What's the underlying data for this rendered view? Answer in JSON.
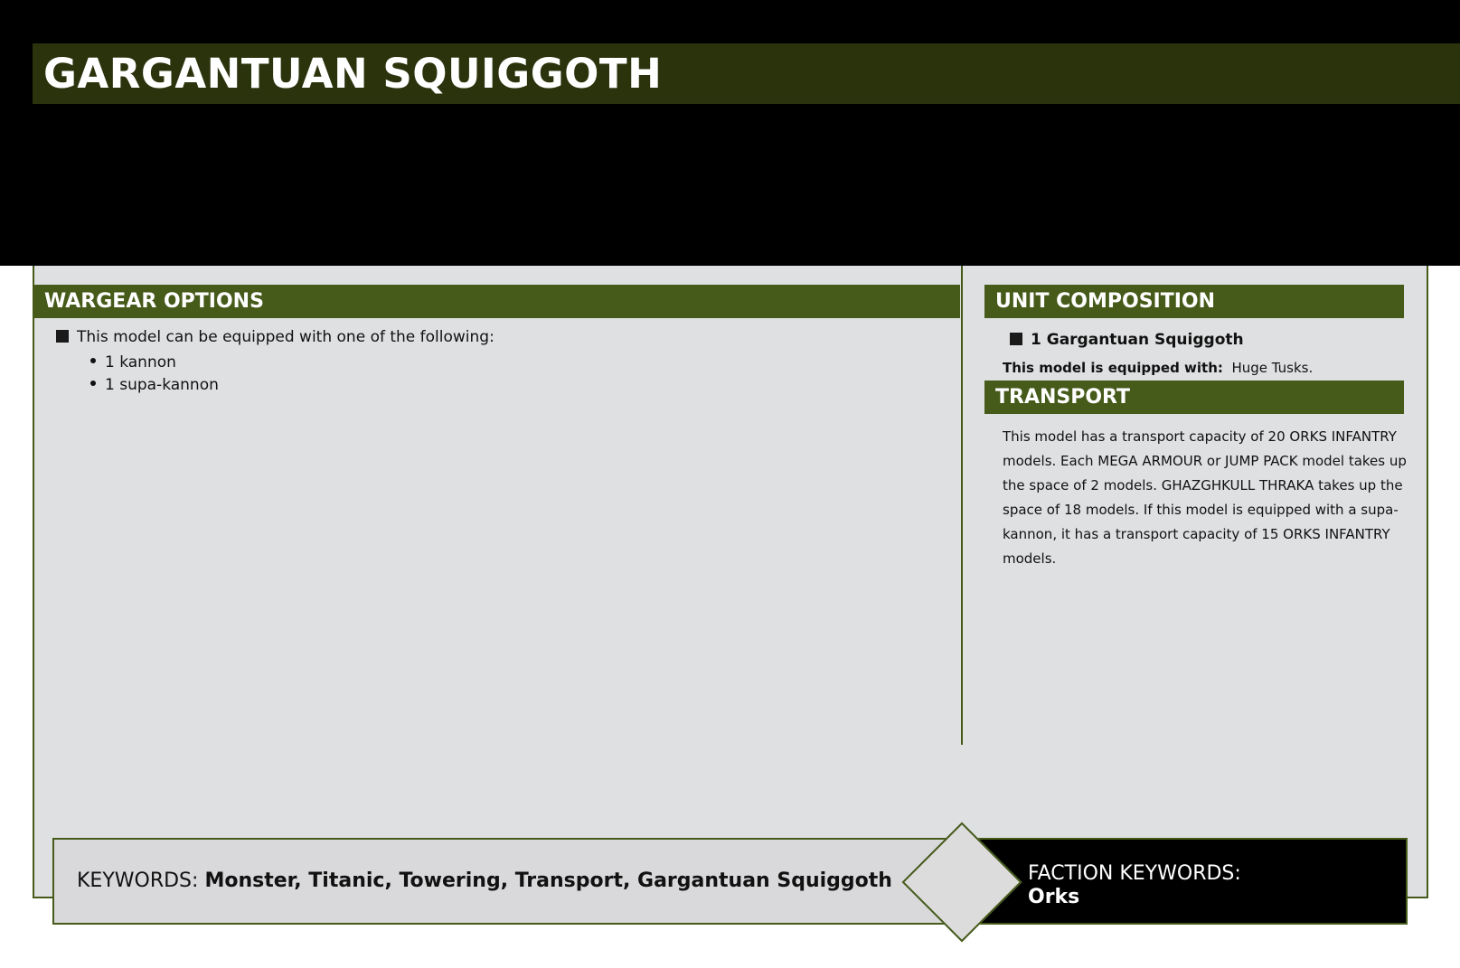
{
  "card": {
    "title": "GARGANTUAN SQUIGGOTH"
  },
  "wargear": {
    "header": "WARGEAR OPTIONS",
    "intro": "This model can be equipped with one of the following:",
    "options": [
      "1 kannon",
      "1 supa-kannon"
    ]
  },
  "unit_composition": {
    "header": "UNIT COMPOSITION",
    "item": "1 Gargantuan Squiggoth",
    "equipped_label": "This model is equipped with:",
    "equipped_value": "Huge Tusks."
  },
  "transport": {
    "header": "TRANSPORT",
    "text": "This model has a transport capacity of 20 ORKS INFANTRY models. Each MEGA ARMOUR or JUMP PACK model takes up the space of 2 models. GHAZGHKULL THRAKA takes up the space of 18 models. If this model is equipped with a supa-kannon, it has a transport capacity of 15 ORKS INFANTRY models."
  },
  "keywords": {
    "label": "KEYWORDS:",
    "values": "Monster, Titanic, Towering, Transport, Gargantuan Squiggoth"
  },
  "faction_keywords": {
    "label": "FACTION KEYWORDS:",
    "values": "Orks"
  },
  "colors": {
    "header_green": "#465a1a",
    "title_bar": "#2a330c",
    "body_bg": "#dfe0e2",
    "band": "#000000"
  }
}
